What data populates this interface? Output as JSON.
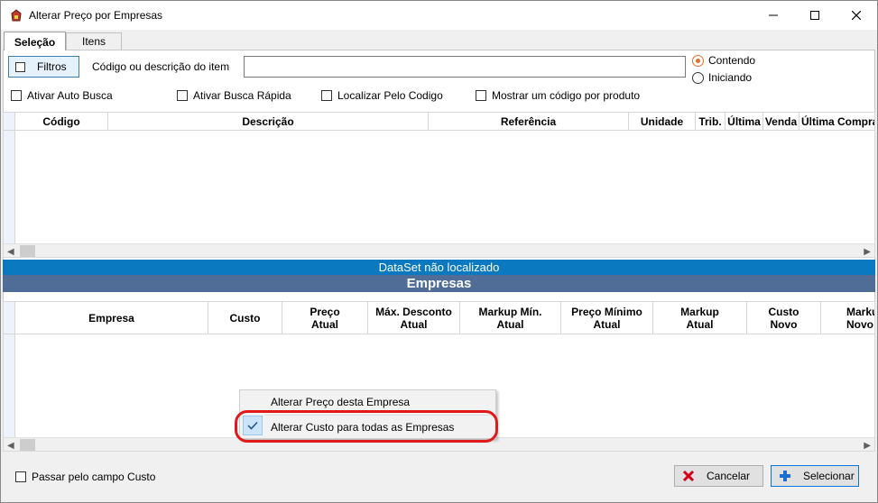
{
  "window": {
    "title": "Alterar Preço por Empresas",
    "controls": {
      "minimize": "minimize-icon",
      "maximize": "maximize-icon",
      "close": "close-icon"
    }
  },
  "tabs": [
    {
      "label": "Seleção",
      "active": true
    },
    {
      "label": "Itens",
      "active": false
    }
  ],
  "filter": {
    "filtros_label": "Filtros",
    "search_label": "Código ou descrição do item",
    "search_value": "",
    "radio_contendo": "Contendo",
    "radio_iniciando": "Iniciando",
    "selected_radio": "Contendo"
  },
  "options": {
    "auto_busca": "Ativar Auto Busca",
    "busca_rapida": "Ativar Busca Rápida",
    "localizar_codigo": "Localizar Pelo Codigo",
    "mostrar_codigo": "Mostrar um código por produto"
  },
  "items_grid": {
    "columns": [
      "Código",
      "Descrição",
      "Referência",
      "Unidade",
      "Trib.",
      "Última",
      "Venda",
      "Última Compra"
    ]
  },
  "status": {
    "dataset_message": "DataSet não localizado",
    "empresas_header": "Empresas"
  },
  "empresas_grid": {
    "columns": [
      {
        "l1": "Empresa",
        "l2": ""
      },
      {
        "l1": "Custo",
        "l2": ""
      },
      {
        "l1": "Preço",
        "l2": "Atual"
      },
      {
        "l1": "Máx. Desconto",
        "l2": "Atual"
      },
      {
        "l1": "Markup Mín.",
        "l2": "Atual"
      },
      {
        "l1": "Preço Mínimo",
        "l2": "Atual"
      },
      {
        "l1": "Markup",
        "l2": "Atual"
      },
      {
        "l1": "Custo",
        "l2": "Novo"
      },
      {
        "l1": "Marku",
        "l2": "Novo"
      }
    ]
  },
  "context_menu": {
    "items": [
      {
        "label": "Alterar Preço desta Empresa",
        "checked": false
      },
      {
        "label": "Alterar Custo para todas as Empresas",
        "checked": true
      }
    ]
  },
  "bottom": {
    "passar_custo": "Passar pelo campo Custo",
    "cancelar": "Cancelar",
    "selecionar": "Selecionar"
  },
  "colors": {
    "dataset_bar": "#0b79c0",
    "empresas_bar": "#4f6d97",
    "highlight": "#e01a1a",
    "radio_accent": "#e0702a"
  }
}
